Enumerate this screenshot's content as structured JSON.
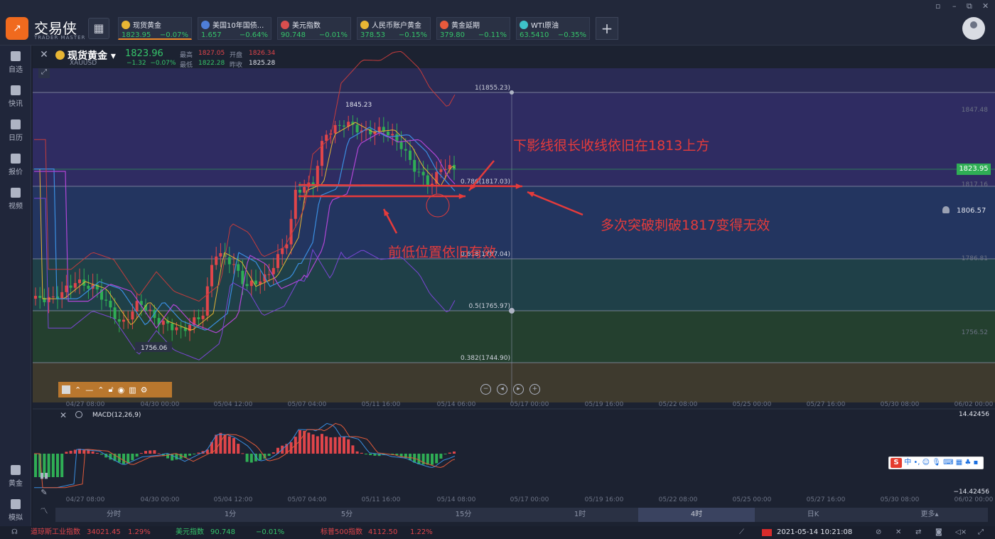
{
  "app": {
    "name": "交易侠",
    "sub": "TRADER MASTER",
    "window_controls": [
      "▫",
      "–",
      "⧉",
      "✕"
    ]
  },
  "tabs": [
    {
      "name": "现货黄金",
      "price": "1823.95",
      "change": "−0.07%",
      "icon": "gold-coin-icon",
      "color": "#e8b634",
      "active": true
    },
    {
      "name": "美国10年国债...",
      "price": "1.657",
      "change": "−0.64%",
      "icon": "bar-chart-icon",
      "color": "#4e7ed8",
      "active": false
    },
    {
      "name": "美元指数",
      "price": "90.748",
      "change": "−0.01%",
      "icon": "us-flag-icon",
      "color": "#d84e4e",
      "active": false
    },
    {
      "name": "人民币账户黄金",
      "price": "378.53",
      "change": "−0.15%",
      "icon": "gold-coin-icon",
      "color": "#e8b634",
      "active": false
    },
    {
      "name": "黄金延期",
      "price": "379.80",
      "change": "−0.11%",
      "icon": "gold-bar-icon",
      "color": "#e85a3c",
      "active": false
    },
    {
      "name": "WTI原油",
      "price": "63.5410",
      "change": "−0.35%",
      "icon": "oil-icon",
      "color": "#3ec2c9",
      "active": false
    }
  ],
  "sidebar": [
    {
      "label": "自选",
      "icon": "star-icon"
    },
    {
      "label": "快讯",
      "icon": "news-icon"
    },
    {
      "label": "日历",
      "icon": "calendar-icon"
    },
    {
      "label": "报价",
      "icon": "quote-icon"
    },
    {
      "label": "视频",
      "icon": "video-icon"
    },
    {
      "label": "黄金",
      "icon": "gold-calc-icon"
    },
    {
      "label": "模拟",
      "icon": "wallet-icon"
    }
  ],
  "instrument": {
    "title": "现货黄金",
    "symbol": "XAUUSD",
    "price": "1823.96",
    "change": "−1.32",
    "change_pct": "−0.07%",
    "high_label": "最高",
    "high": "1827.05",
    "open_label": "开盘",
    "open": "1826.34",
    "low_label": "最低",
    "low": "1822.28",
    "prev_label": "昨收",
    "prev": "1825.28"
  },
  "fib_levels": [
    {
      "label": "1(1855.23)"
    },
    {
      "label": "0.786(1817.03)"
    },
    {
      "label": "0.618(1787.04)"
    },
    {
      "label": "0.5(1765.97)"
    },
    {
      "label": "0.382(1744.90)"
    }
  ],
  "price_axis": [
    "1847.48",
    "1817.16",
    "1786.81",
    "1756.52"
  ],
  "price_badge": "1823.95",
  "alert_price": "1806.57",
  "extreme_high": "1845.23",
  "extreme_low": "1756.06",
  "time_axis": [
    "04/27 08:00",
    "04/30 00:00",
    "05/04 12:00",
    "05/07 04:00",
    "05/11 16:00",
    "05/14 06:00",
    "05/17 00:00",
    "05/19 16:00",
    "05/22 08:00",
    "05/25 00:00",
    "05/27 16:00",
    "05/30 08:00",
    "06/02 00:00"
  ],
  "time_axis2": [
    "04/27 08:00",
    "04/30 00:00",
    "05/04 12:00",
    "05/07 04:00",
    "05/11 16:00",
    "05/14 08:00",
    "05/17 00:00",
    "05/19 16:00",
    "05/22 08:00",
    "05/25 00:00",
    "05/27 16:00",
    "05/30 08:00",
    "06/02 00:00"
  ],
  "macd": {
    "label": "MACD(12,26,9)",
    "axis_top": "14.42456",
    "axis_bottom": "−14.42456"
  },
  "annotations": {
    "a1": "下影线很长收线依旧在1813上方",
    "a2": "多次突破刺破1817变得无效",
    "a3": "前低位置依旧有效"
  },
  "timeframes": [
    {
      "label": "分时",
      "on": false
    },
    {
      "label": "1分",
      "on": false
    },
    {
      "label": "5分",
      "on": false
    },
    {
      "label": "15分",
      "on": false
    },
    {
      "label": "1时",
      "on": false
    },
    {
      "label": "4时",
      "on": true
    },
    {
      "label": "日K",
      "on": false
    },
    {
      "label": "更多▴",
      "on": false
    }
  ],
  "status": {
    "dow_name": "道琼斯工业指数",
    "dow_val": "34021.45",
    "dow_chg": "1.29%",
    "usd_name": "美元指数",
    "usd_val": "90.748",
    "usd_chg": "−0.01%",
    "sp_name": "标普500指数",
    "sp_val": "4112.50",
    "sp_chg": "1.22%",
    "datetime": "2021-05-14 10:21:08"
  },
  "ime": {
    "brand": "S",
    "lang": "中"
  },
  "colors": {
    "up": "#e0454a",
    "down": "#2fae55",
    "accent": "#f08a2a",
    "anno": "#e53b3b"
  }
}
